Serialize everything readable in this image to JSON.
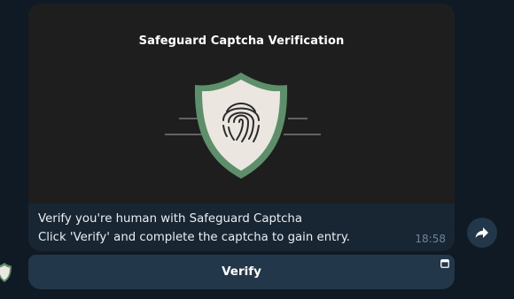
{
  "message": {
    "banner_title": "Safeguard Captcha Verification",
    "caption_line1": "Verify you're human with Safeguard Captcha",
    "caption_line2": "Click 'Verify' and complete the captcha to gain entry.",
    "time": "18:58",
    "verify_button_label": "Verify"
  },
  "icons": {
    "shield": "shield-fingerprint-icon",
    "web_app": "web-app-icon",
    "forward": "forward-arrow-icon",
    "avatar": "shield-avatar-icon"
  },
  "colors": {
    "chat_background": "#0f1a25",
    "bubble": "#182533",
    "banner": "#1e1e1f",
    "button": "#22384a",
    "shield_green": "#5c8f6a",
    "time_text": "#6d8499"
  }
}
